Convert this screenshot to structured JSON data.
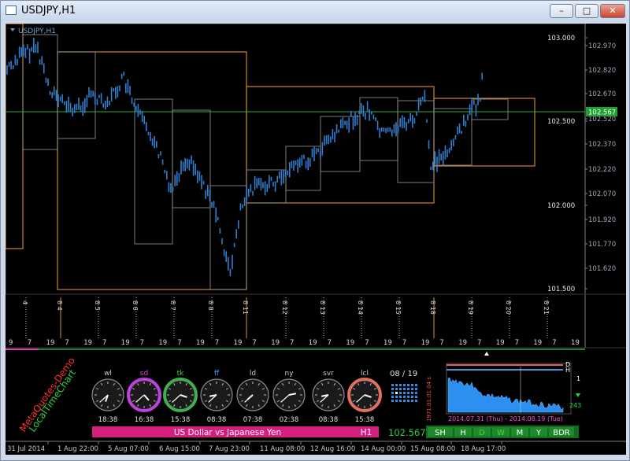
{
  "window": {
    "title": "USDJPY,H1",
    "min_label": "–",
    "max_label": "□",
    "close_label": "✕"
  },
  "chart_data": {
    "type": "candlestick-line",
    "symbol_label": "USDJPY,H1",
    "price_axis": {
      "ticks": [
        "103.000",
        "102.970",
        "102.820",
        "102.670",
        "102.520",
        "102.500",
        "102.370",
        "102.220",
        "102.070",
        "102.000",
        "101.920",
        "101.770",
        "101.620",
        "101.500"
      ],
      "current": "102.567"
    },
    "time_axis": [
      "31 Jul 2014",
      "1 Aug 22:00",
      "5 Aug 07:00",
      "6 Aug 15:00",
      "7 Aug 23:00",
      "11 Aug 08:00",
      "12 Aug 16:00",
      "14 Aug 00:00",
      "15 Aug 08:00",
      "18 Aug 17:00"
    ],
    "day_markers": [
      "4",
      "8 4",
      "8 5",
      "8 6",
      "8 7",
      "8 8",
      "8 11",
      "8 12",
      "8 13",
      "8 14",
      "8 15",
      "8 18",
      "8 19",
      "8 20",
      "8 21"
    ],
    "hour_labels": [
      "9",
      "7",
      "19",
      "7",
      "19",
      "7",
      "19",
      "7",
      "19",
      "7",
      "19",
      "7",
      "19",
      "7",
      "19",
      "7",
      "19",
      "7",
      "19",
      "7",
      "19",
      "7",
      "19",
      "7",
      "19",
      "7",
      "19",
      "7",
      "19",
      "7",
      "19"
    ]
  },
  "clocks": [
    {
      "name": "wl",
      "time": "18:38",
      "ring": "#8a8a8a",
      "name_color": "#cccccc"
    },
    {
      "name": "sd",
      "time": "16:38",
      "ring": "#c040e0",
      "name_color": "#e040e0"
    },
    {
      "name": "tk",
      "time": "15:38",
      "ring": "#3fb04f",
      "name_color": "#40d040"
    },
    {
      "name": "ff",
      "time": "08:38",
      "ring": "#8a8a8a",
      "name_color": "#40a0ff"
    },
    {
      "name": "ld",
      "time": "07:38",
      "ring": "#8a8a8a",
      "name_color": "#cccccc"
    },
    {
      "name": "ny",
      "time": "02:38",
      "ring": "#8a8a8a",
      "name_color": "#cccccc"
    },
    {
      "name": "svr",
      "time": "08:38",
      "ring": "#8a8a8a",
      "name_color": "#cccccc"
    },
    {
      "name": "lcl",
      "time": "15:38",
      "ring": "#e07060",
      "name_color": "#cccccc"
    }
  ],
  "widget": {
    "pager": "08 / 19",
    "watermark1": "MetaQuotes-Demo",
    "watermark2": "LocalTimeChart",
    "pair_name": "US Dollar vs Japanese Yen",
    "timeframe": "H1",
    "price": "102.567",
    "buttons": [
      "SH",
      "H",
      "D",
      "W",
      "M",
      "Y",
      "BDR"
    ],
    "mini_range": "2014.07.31 (Thu) - 2014.08.19 (Tue)",
    "mini_labels": [
      "D",
      "H"
    ],
    "mini_right_top": "1",
    "mini_right_bottom": "243",
    "mini_side": "1971.01.01 04 s"
  }
}
